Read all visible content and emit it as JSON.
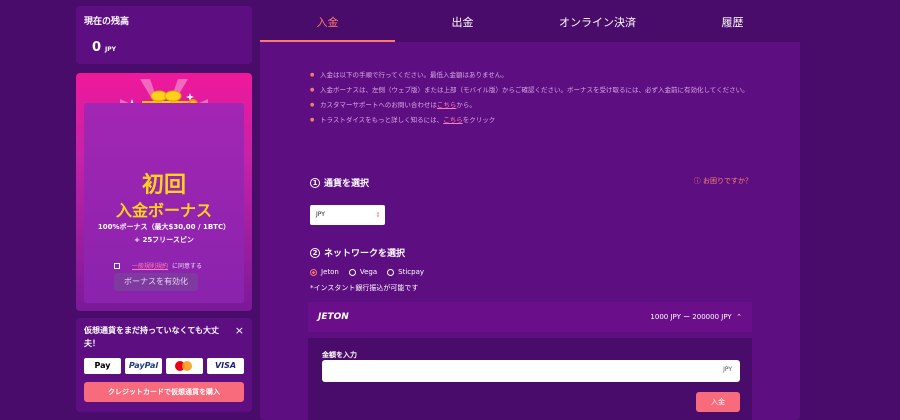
{
  "balance": {
    "label": "現在の残高",
    "amount": "0",
    "currency": "JPY"
  },
  "bonus": {
    "title_line1": "初回",
    "title_line2": "入金ボーナス",
    "desc_line1": "100%ボーナス（最大$30,00 / 1BTC）",
    "desc_line2": "+ 25フリースピン",
    "agree_link": "一般規則規約",
    "agree_suffix": "に同意する",
    "activate_label": "ボーナスを有効化",
    "info_icon": "i"
  },
  "crypto": {
    "message": "仮想通貨をまだ持っていなくても大丈夫！",
    "close": "×",
    "apple_pay": " Pay",
    "paypal": "PayPal",
    "visa": "VISA",
    "buy_label": "クレジットカードで仮想通貨を購入"
  },
  "tabs": [
    {
      "label": "入金"
    },
    {
      "label": "出金"
    },
    {
      "label": "オンライン決済"
    },
    {
      "label": "履歴"
    }
  ],
  "notes": {
    "n1": "入金は以下の手順で行ってください。最低入金額はありません。",
    "n2": "入金ボーナスは、左側（ウェブ版）または上部（モバイル版）からご確認ください。ボーナスを受け取るには、必ず入金前に有効化してください。",
    "n3_prefix": "カスタマーサポートへのお問い合わせは",
    "n3_link": "こちら",
    "n3_suffix": "から。",
    "n4_prefix": "トラストダイスをもっと詳しく知るには、",
    "n4_link": "こちら",
    "n4_suffix": "をクリック"
  },
  "step1": {
    "num": "1",
    "label": "通貨を選択"
  },
  "help": "ⓘ お困りですか？",
  "currency_select": {
    "value": "JPY",
    "arrows": "⇕"
  },
  "step2": {
    "num": "2",
    "label": "ネットワークを選択"
  },
  "networks": [
    {
      "label": "Jeton",
      "selected": true
    },
    {
      "label": "Vega",
      "selected": false
    },
    {
      "label": "Sticpay",
      "selected": false
    }
  ],
  "instant_note": "*インスタント銀行振込が可能です",
  "jeton": {
    "name": "JETON",
    "range": "1000 JPY ー 200000 JPY",
    "chevron": "⌃",
    "amount_label": "金額を入力",
    "amount_currency": "JPY",
    "deposit_label": "入金"
  },
  "colors": {
    "bg": "#4a0c6b",
    "panel": "#5d0f82",
    "accent": "#ff7a6b",
    "gold": "#ffd21a",
    "button": "#f86b7d"
  }
}
